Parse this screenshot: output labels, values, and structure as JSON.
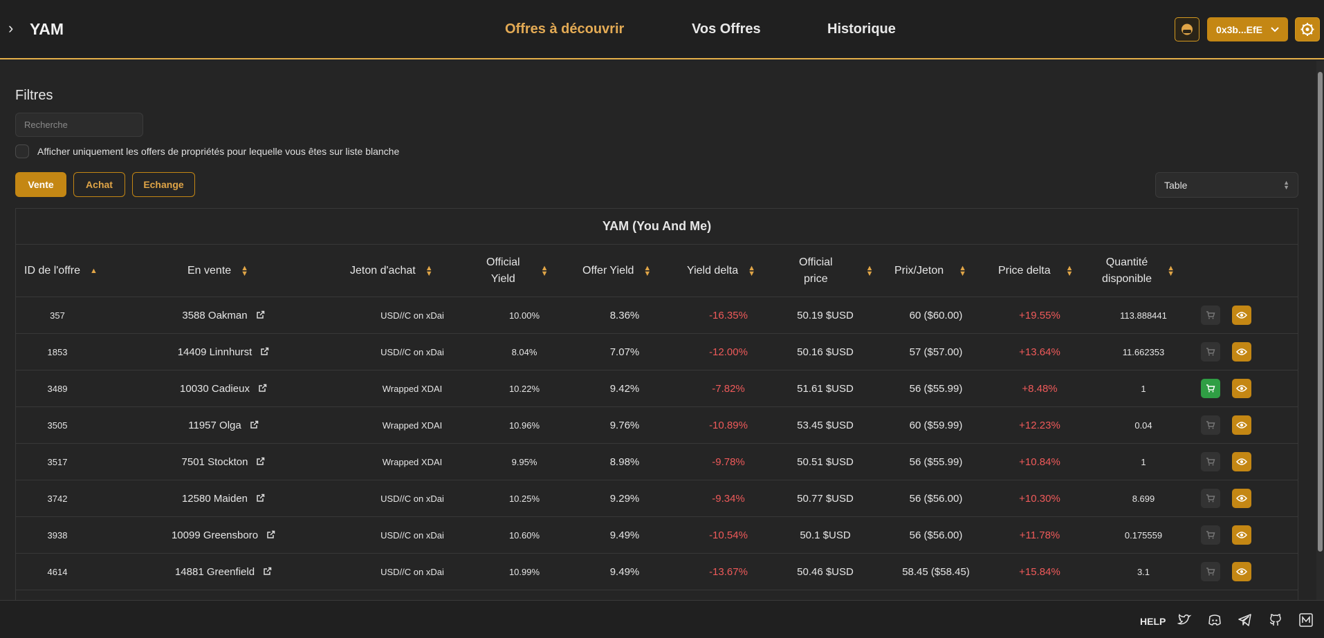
{
  "app": {
    "logo": "YAM"
  },
  "nav": [
    {
      "label": "Offres à découvrir",
      "active": true
    },
    {
      "label": "Vos Offres",
      "active": false
    },
    {
      "label": "Historique",
      "active": false
    }
  ],
  "wallet": {
    "address": "0x3b...EfE"
  },
  "filters": {
    "title": "Filtres",
    "search_placeholder": "Recherche",
    "whitelist_label": "Afficher uniquement les offers de propriétés pour lequelle vous êtes sur liste blanche",
    "types": [
      "Vente",
      "Achat",
      "Echange"
    ],
    "view": "Table"
  },
  "table": {
    "title": "YAM (You And Me)",
    "columns": [
      {
        "l1": "ID de l'offre",
        "l2": ""
      },
      {
        "l1": "En vente",
        "l2": ""
      },
      {
        "l1": "Jeton d'achat",
        "l2": ""
      },
      {
        "l1": "Official",
        "l2": "Yield"
      },
      {
        "l1": "Offer Yield",
        "l2": ""
      },
      {
        "l1": "Yield delta",
        "l2": ""
      },
      {
        "l1": "Official",
        "l2": "price"
      },
      {
        "l1": "Prix/Jeton",
        "l2": ""
      },
      {
        "l1": "Price delta",
        "l2": ""
      },
      {
        "l1": "Quantité",
        "l2": "disponible"
      }
    ],
    "rows": [
      {
        "id": "357",
        "name": "3588 Oakman",
        "token": "USD//C on xDai",
        "official_yield": "10.00%",
        "offer_yield": "8.36%",
        "yield_delta": "-16.35%",
        "official_price": "50.19 $USD",
        "price": "60 ($60.00)",
        "price_delta": "+19.55%",
        "qty": "113.888441",
        "buyable": false
      },
      {
        "id": "1853",
        "name": "14409 Linnhurst",
        "token": "USD//C on xDai",
        "official_yield": "8.04%",
        "offer_yield": "7.07%",
        "yield_delta": "-12.00%",
        "official_price": "50.16 $USD",
        "price": "57 ($57.00)",
        "price_delta": "+13.64%",
        "qty": "11.662353",
        "buyable": false
      },
      {
        "id": "3489",
        "name": "10030 Cadieux",
        "token": "Wrapped XDAI",
        "official_yield": "10.22%",
        "offer_yield": "9.42%",
        "yield_delta": "-7.82%",
        "official_price": "51.61 $USD",
        "price": "56 ($55.99)",
        "price_delta": "+8.48%",
        "qty": "1",
        "buyable": true
      },
      {
        "id": "3505",
        "name": "11957 Olga",
        "token": "Wrapped XDAI",
        "official_yield": "10.96%",
        "offer_yield": "9.76%",
        "yield_delta": "-10.89%",
        "official_price": "53.45 $USD",
        "price": "60 ($59.99)",
        "price_delta": "+12.23%",
        "qty": "0.04",
        "buyable": false
      },
      {
        "id": "3517",
        "name": "7501 Stockton",
        "token": "Wrapped XDAI",
        "official_yield": "9.95%",
        "offer_yield": "8.98%",
        "yield_delta": "-9.78%",
        "official_price": "50.51 $USD",
        "price": "56 ($55.99)",
        "price_delta": "+10.84%",
        "qty": "1",
        "buyable": false
      },
      {
        "id": "3742",
        "name": "12580 Maiden",
        "token": "USD//C on xDai",
        "official_yield": "10.25%",
        "offer_yield": "9.29%",
        "yield_delta": "-9.34%",
        "official_price": "50.77 $USD",
        "price": "56 ($56.00)",
        "price_delta": "+10.30%",
        "qty": "8.699",
        "buyable": false
      },
      {
        "id": "3938",
        "name": "10099 Greensboro",
        "token": "USD//C on xDai",
        "official_yield": "10.60%",
        "offer_yield": "9.49%",
        "yield_delta": "-10.54%",
        "official_price": "50.1 $USD",
        "price": "56 ($56.00)",
        "price_delta": "+11.78%",
        "qty": "0.175559",
        "buyable": false
      },
      {
        "id": "4614",
        "name": "14881 Greenfield",
        "token": "USD//C on xDai",
        "official_yield": "10.99%",
        "offer_yield": "9.49%",
        "yield_delta": "-13.67%",
        "official_price": "50.46 $USD",
        "price": "58.45 ($58.45)",
        "price_delta": "+15.84%",
        "qty": "3.1",
        "buyable": false
      }
    ]
  },
  "footer": {
    "help": "HELP",
    "icons": [
      "twitter-icon",
      "discord-icon",
      "telegram-icon",
      "github-icon",
      "medium-icon"
    ]
  },
  "colors": {
    "accent": "#c48714",
    "accent_text": "#e4ab55",
    "negative": "#ef5a5a",
    "buy_ok": "#2f9e44"
  }
}
